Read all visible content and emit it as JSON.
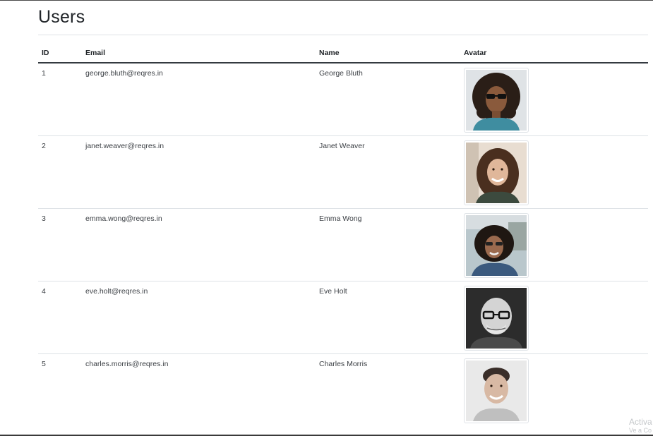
{
  "page": {
    "title": "Users"
  },
  "table": {
    "headers": {
      "id": "ID",
      "email": "Email",
      "name": "Name",
      "avatar": "Avatar"
    },
    "rows": [
      {
        "id": "1",
        "email": "george.bluth@reqres.in",
        "name": "George Bluth",
        "avatar_icon": "avatar-photo-george"
      },
      {
        "id": "2",
        "email": "janet.weaver@reqres.in",
        "name": "Janet Weaver",
        "avatar_icon": "avatar-photo-janet"
      },
      {
        "id": "3",
        "email": "emma.wong@reqres.in",
        "name": "Emma Wong",
        "avatar_icon": "avatar-photo-emma"
      },
      {
        "id": "4",
        "email": "eve.holt@reqres.in",
        "name": "Eve Holt",
        "avatar_icon": "avatar-photo-eve"
      },
      {
        "id": "5",
        "email": "charles.morris@reqres.in",
        "name": "Charles Morris",
        "avatar_icon": "avatar-photo-charles"
      }
    ]
  },
  "watermark": {
    "line1": "Activa",
    "line2": "Ve a Co"
  },
  "colors": {
    "text": "#212529",
    "rule": "#dee2e6",
    "header_rule": "#343a40"
  }
}
